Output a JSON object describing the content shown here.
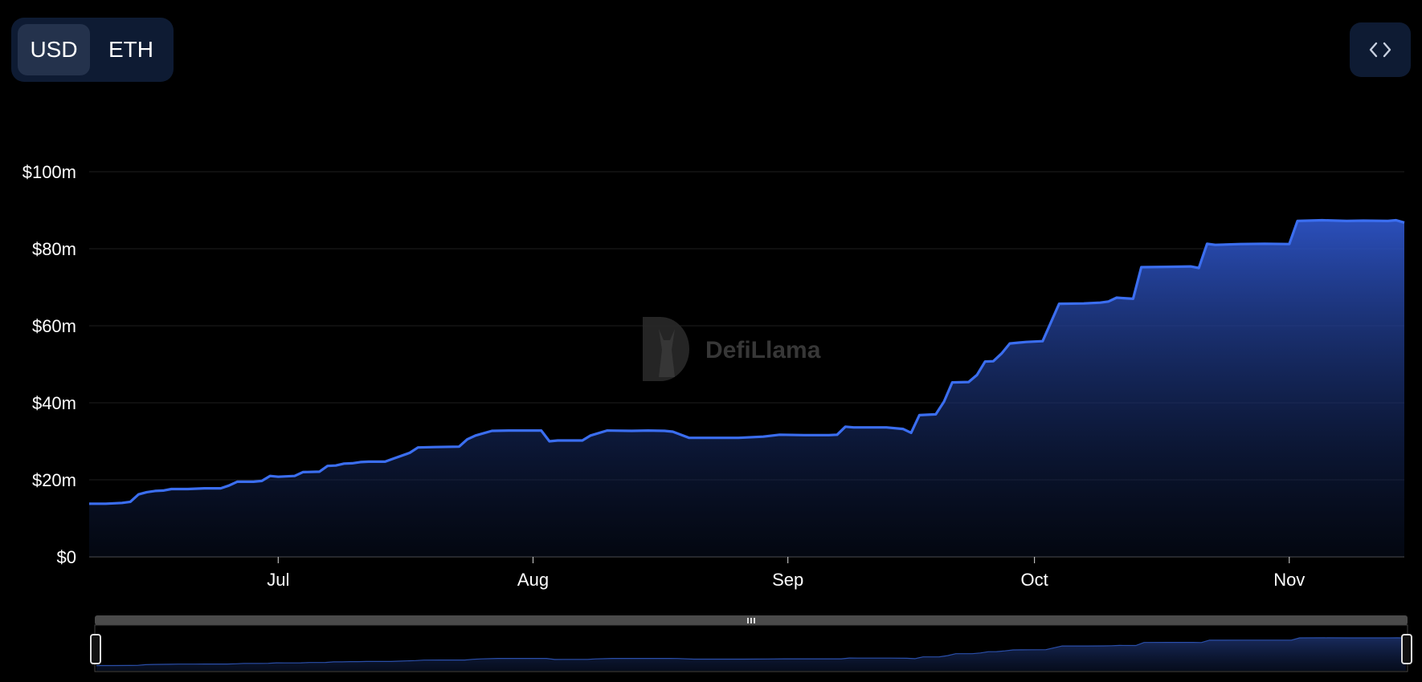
{
  "toggle": {
    "usd_label": "USD",
    "eth_label": "ETH",
    "selected": "USD"
  },
  "embed": {
    "icon": "code-brackets-icon"
  },
  "watermark": {
    "text": "DefiLlama"
  },
  "colors": {
    "line": "#3b6ef0",
    "area_top": "#2d53c4",
    "background": "#000000",
    "panel": "#0e1b33"
  },
  "chart_data": {
    "type": "area",
    "xlabel": "",
    "ylabel": "",
    "y_ticks": [
      "$0",
      "$20m",
      "$40m",
      "$60m",
      "$80m",
      "$100m"
    ],
    "x_ticks": [
      "Jul",
      "Aug",
      "Sep",
      "Oct",
      "Nov"
    ],
    "ylim": [
      0,
      100
    ],
    "grid": true,
    "series": [
      {
        "points": [
          [
            "Jun 8",
            13.8
          ],
          [
            "Jun 10",
            13.8
          ],
          [
            "Jun 12",
            14.0
          ],
          [
            "Jun 13",
            14.3
          ],
          [
            "Jun 14",
            16.2
          ],
          [
            "Jun 15",
            16.8
          ],
          [
            "Jun 16",
            17.1
          ],
          [
            "Jun 17",
            17.2
          ],
          [
            "Jun 18",
            17.6
          ],
          [
            "Jun 20",
            17.6
          ],
          [
            "Jun 22",
            17.8
          ],
          [
            "Jun 24",
            17.8
          ],
          [
            "Jun 25",
            18.5
          ],
          [
            "Jun 26",
            19.5
          ],
          [
            "Jun 28",
            19.5
          ],
          [
            "Jun 29",
            19.7
          ],
          [
            "Jun 30",
            21.0
          ],
          [
            "Jul 1",
            20.8
          ],
          [
            "Jul 3",
            21.0
          ],
          [
            "Jul 4",
            22.0
          ],
          [
            "Jul 6",
            22.1
          ],
          [
            "Jul 7",
            23.6
          ],
          [
            "Jul 8",
            23.7
          ],
          [
            "Jul 9",
            24.2
          ],
          [
            "Jul 10",
            24.3
          ],
          [
            "Jul 11",
            24.6
          ],
          [
            "Jul 12",
            24.7
          ],
          [
            "Jul 14",
            24.7
          ],
          [
            "Jul 15",
            25.5
          ],
          [
            "Jul 17",
            27.0
          ],
          [
            "Jul 18",
            28.4
          ],
          [
            "Jul 20",
            28.5
          ],
          [
            "Jul 23",
            28.6
          ],
          [
            "Jul 24",
            30.5
          ],
          [
            "Jul 25",
            31.5
          ],
          [
            "Jul 27",
            32.7
          ],
          [
            "Jul 29",
            32.8
          ],
          [
            "Aug 2",
            32.8
          ],
          [
            "Aug 3",
            30.0
          ],
          [
            "Aug 4",
            30.2
          ],
          [
            "Aug 7",
            30.2
          ],
          [
            "Aug 8",
            31.5
          ],
          [
            "Aug 10",
            32.8
          ],
          [
            "Aug 13",
            32.7
          ],
          [
            "Aug 15",
            32.8
          ],
          [
            "Aug 17",
            32.7
          ],
          [
            "Aug 18",
            32.5
          ],
          [
            "Aug 20",
            30.9
          ],
          [
            "Aug 22",
            30.9
          ],
          [
            "Aug 26",
            30.9
          ],
          [
            "Aug 29",
            31.2
          ],
          [
            "Aug 31",
            31.7
          ],
          [
            "Sep 3",
            31.6
          ],
          [
            "Sep 6",
            31.6
          ],
          [
            "Sep 7",
            31.7
          ],
          [
            "Sep 8",
            33.8
          ],
          [
            "Sep 9",
            33.6
          ],
          [
            "Sep 13",
            33.6
          ],
          [
            "Sep 15",
            33.2
          ],
          [
            "Sep 16",
            32.2
          ],
          [
            "Sep 17",
            36.8
          ],
          [
            "Sep 19",
            37.0
          ],
          [
            "Sep 20",
            40.3
          ],
          [
            "Sep 21",
            45.3
          ],
          [
            "Sep 23",
            45.4
          ],
          [
            "Sep 24",
            47.2
          ],
          [
            "Sep 25",
            50.7
          ],
          [
            "Sep 26",
            50.8
          ],
          [
            "Sep 27",
            52.8
          ],
          [
            "Sep 28",
            55.4
          ],
          [
            "Sep 29",
            55.6
          ],
          [
            "Sep 30",
            55.8
          ],
          [
            "Oct 2",
            56.0
          ],
          [
            "Oct 4",
            65.7
          ],
          [
            "Oct 7",
            65.8
          ],
          [
            "Oct 9",
            66.0
          ],
          [
            "Oct 10",
            66.3
          ],
          [
            "Oct 11",
            67.3
          ],
          [
            "Oct 13",
            67.0
          ],
          [
            "Oct 14",
            75.2
          ],
          [
            "Oct 17",
            75.3
          ],
          [
            "Oct 20",
            75.4
          ],
          [
            "Oct 21",
            75.0
          ],
          [
            "Oct 22",
            81.3
          ],
          [
            "Oct 23",
            81.0
          ],
          [
            "Oct 26",
            81.2
          ],
          [
            "Oct 29",
            81.3
          ],
          [
            "Nov 1",
            81.2
          ],
          [
            "Nov 2",
            87.2
          ],
          [
            "Nov 5",
            87.4
          ],
          [
            "Nov 8",
            87.2
          ],
          [
            "Nov 10",
            87.3
          ],
          [
            "Nov 13",
            87.2
          ],
          [
            "Nov 14",
            87.4
          ],
          [
            "Nov 15",
            86.8
          ]
        ]
      }
    ]
  }
}
